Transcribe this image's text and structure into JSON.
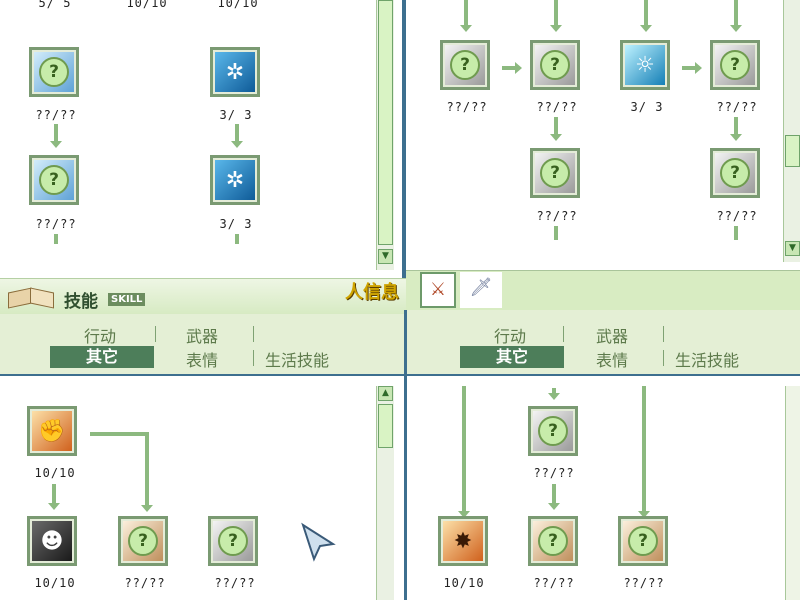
{
  "top_left": {
    "counts_row0": [
      "5/ 5",
      "10/10",
      "10/10"
    ],
    "nodes": [
      {
        "count": "??/??",
        "icon": "question-blue-icon"
      },
      {
        "count": "3/ 3",
        "icon": "spin-blade-icon"
      },
      {
        "count": "??/??",
        "icon": "question-blue-icon"
      },
      {
        "count": "3/ 3",
        "icon": "spin-blade-icon"
      }
    ],
    "partial_counts": [
      "??/??",
      "??/??"
    ]
  },
  "top_right": {
    "nodes": [
      {
        "count": "??/??",
        "icon": "question-silver-icon"
      },
      {
        "count": "??/??",
        "icon": "question-silver-icon"
      },
      {
        "count": "3/ 3",
        "icon": "burst-face-icon"
      },
      {
        "count": "??/??",
        "icon": "question-silver-icon"
      },
      {
        "count": "??/??",
        "icon": "question-silver-icon"
      },
      {
        "count": "??/??",
        "icon": "question-silver-icon"
      }
    ]
  },
  "skill_header": {
    "title": "技能",
    "title_en": "SKILL",
    "side_text": "人信息"
  },
  "tabs_left": {
    "items": [
      "行动",
      "武器",
      "其它",
      "表情",
      "生活技能"
    ],
    "active": "其它"
  },
  "tabs_right": {
    "items": [
      "行动",
      "武器",
      "其它",
      "表情",
      "生活技能"
    ],
    "active": "其它"
  },
  "bottom_left": {
    "nodes": [
      {
        "count": "10/10",
        "icon": "fist-icon"
      },
      {
        "count": "10/10",
        "icon": "face-icon"
      },
      {
        "count": "??/??",
        "icon": "question-tan-icon"
      },
      {
        "count": "??/??",
        "icon": "question-silver-icon"
      }
    ]
  },
  "bottom_right": {
    "nodes": [
      {
        "count": "??/??",
        "icon": "question-silver-icon"
      },
      {
        "count": "10/10",
        "icon": "burst-figure-icon"
      },
      {
        "count": "??/??",
        "icon": "question-tan-icon"
      },
      {
        "count": "??/??",
        "icon": "question-tan-icon"
      }
    ]
  }
}
